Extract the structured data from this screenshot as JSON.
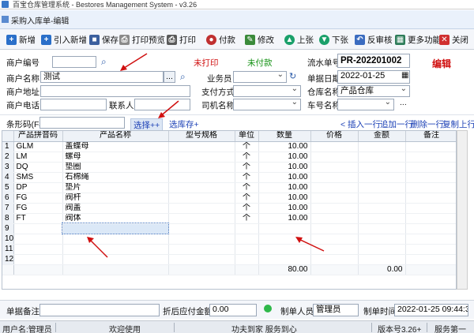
{
  "window": {
    "title": "百宝仓库管理系统 - Bestores Management System - v3.26"
  },
  "tab": {
    "title": "采购入库单-编辑"
  },
  "toolbar": {
    "new": "新增",
    "import_new": "引入新增",
    "save": "保存",
    "print_preview": "打印预览",
    "print": "打印",
    "pay": "付款",
    "edit": "修改",
    "prev": "上张",
    "next": "下张",
    "unaudit": "反审核",
    "more": "更多功能",
    "close": "关闭"
  },
  "form": {
    "merchant_code_label": "商户编号",
    "merchant_code": "",
    "print_status": "未打印",
    "pay_status": "未付款",
    "serial_label": "流水单号",
    "serial_no": "PR-202201002",
    "edit_badge": "编辑",
    "merchant_name_label": "商户名称",
    "merchant_name": "测试",
    "browse": "...",
    "clerk_label": "业务员",
    "clerk": "",
    "date_label": "单据日期",
    "date": "2022-01-25",
    "address_label": "商户地址",
    "address": "",
    "pay_method_label": "支付方式",
    "pay_method": "",
    "warehouse_label": "仓库名称",
    "warehouse": "产品仓库",
    "phone_label": "商户电话",
    "phone": "",
    "contact_label": "联系人",
    "contact": "",
    "driver_label": "司机名称",
    "driver": "",
    "plate_label": "车号名称",
    "plate": ""
  },
  "barcode": {
    "label": "条形码(F4)",
    "value": "",
    "select_link": "选择++",
    "stock_link": "选库存+",
    "insert_row": "< 插入一行",
    "append_row": "追加一行",
    "delete_row": "删除一行",
    "copy_row": "复制上行"
  },
  "grid": {
    "headers": [
      "产品拼音码",
      "产品名称",
      "型号规格",
      "单位",
      "数量",
      "价格",
      "金额",
      "备注"
    ],
    "rows": [
      {
        "n": "1",
        "code": "GLM",
        "name": "盖蝶母",
        "spec": "",
        "unit": "个",
        "qty": "10.00",
        "price": "",
        "amount": "",
        "note": ""
      },
      {
        "n": "2",
        "code": "LM",
        "name": "螺母",
        "spec": "",
        "unit": "个",
        "qty": "10.00",
        "price": "",
        "amount": "",
        "note": ""
      },
      {
        "n": "3",
        "code": "DQ",
        "name": "垫圈",
        "spec": "",
        "unit": "个",
        "qty": "10.00",
        "price": "",
        "amount": "",
        "note": ""
      },
      {
        "n": "4",
        "code": "SMS",
        "name": "石棉绳",
        "spec": "",
        "unit": "个",
        "qty": "10.00",
        "price": "",
        "amount": "",
        "note": ""
      },
      {
        "n": "5",
        "code": "DP",
        "name": "垫片",
        "spec": "",
        "unit": "个",
        "qty": "10.00",
        "price": "",
        "amount": "",
        "note": ""
      },
      {
        "n": "6",
        "code": "FG",
        "name": "阀杆",
        "spec": "",
        "unit": "个",
        "qty": "10.00",
        "price": "",
        "amount": "",
        "note": ""
      },
      {
        "n": "7",
        "code": "FG",
        "name": "阀盖",
        "spec": "",
        "unit": "个",
        "qty": "10.00",
        "price": "",
        "amount": "",
        "note": ""
      },
      {
        "n": "8",
        "code": "FT",
        "name": "阀体",
        "spec": "",
        "unit": "个",
        "qty": "10.00",
        "price": "",
        "amount": "",
        "note": ""
      },
      {
        "n": "9",
        "code": "",
        "name": "",
        "spec": "",
        "unit": "",
        "qty": "",
        "price": "",
        "amount": "",
        "note": ""
      },
      {
        "n": "10",
        "code": "",
        "name": "",
        "spec": "",
        "unit": "",
        "qty": "",
        "price": "",
        "amount": "",
        "note": ""
      },
      {
        "n": "11",
        "code": "",
        "name": "",
        "spec": "",
        "unit": "",
        "qty": "",
        "price": "",
        "amount": "",
        "note": ""
      },
      {
        "n": "12",
        "code": "",
        "name": "",
        "spec": "",
        "unit": "",
        "qty": "",
        "price": "",
        "amount": "",
        "note": ""
      }
    ],
    "total_qty": "80.00",
    "total_amount": "0.00"
  },
  "footer": {
    "remark_label": "单据备注",
    "remark": "",
    "discount_label": "折后应付金额",
    "discount": "0.00",
    "creator_label": "制单人员",
    "creator": "管理员",
    "created_label": "制单时间",
    "created_at": "2022-01-25 09:44:31"
  },
  "status": {
    "user": "用户名:管理员",
    "welcome": "欢迎使用",
    "slogan": "功夫到家 服务到心",
    "version": "版本号3.26+",
    "service": "服务第一"
  },
  "colors": {
    "accent": "#1a3fb5",
    "red": "#d01010",
    "green": "#109010"
  }
}
